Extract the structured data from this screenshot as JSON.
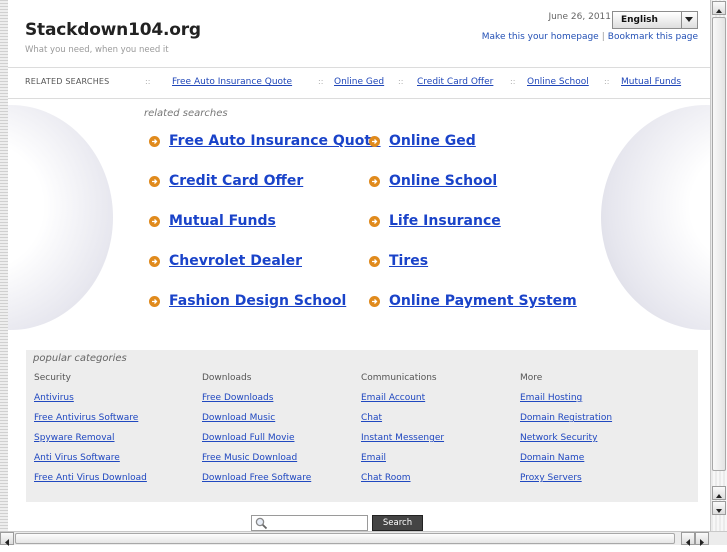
{
  "header": {
    "site_title": "Stackdown104.org",
    "tagline": "What you need, when you need it",
    "date": "June 26, 2011",
    "language": "English",
    "homepage_link": "Make this your homepage",
    "bookmark_link": "Bookmark this page"
  },
  "related_bar": {
    "label": "RELATED SEARCHES",
    "separator": "::",
    "links": [
      "Free Auto Insurance Quote",
      "Online Ged",
      "Credit Card Offer",
      "Online School",
      "Mutual Funds"
    ]
  },
  "related_searches": {
    "heading": "related searches",
    "left": [
      "Free Auto Insurance Quote",
      "Credit Card Offer",
      "Mutual Funds",
      "Chevrolet Dealer",
      "Fashion Design School"
    ],
    "right": [
      "Online Ged",
      "Online School",
      "Life Insurance",
      "Tires",
      "Online Payment System"
    ]
  },
  "popular": {
    "heading": "popular categories",
    "columns": [
      {
        "title": "Security",
        "links": [
          "Antivirus",
          "Free Antivirus Software",
          "Spyware Removal",
          "Anti Virus Software",
          "Free Anti Virus Download"
        ]
      },
      {
        "title": "Downloads",
        "links": [
          "Free Downloads",
          "Download Music",
          "Download Full Movie",
          "Free Music Download",
          "Download Free Software"
        ]
      },
      {
        "title": "Communications",
        "links": [
          "Email Account",
          "Chat",
          "Instant Messenger",
          "Email",
          "Chat Room"
        ]
      },
      {
        "title": "More",
        "links": [
          "Email Hosting",
          "Domain Registration",
          "Network Security",
          "Domain Name",
          "Proxy Servers"
        ]
      }
    ]
  },
  "search": {
    "placeholder": "",
    "button_label": "Search"
  },
  "colors": {
    "link": "#1a43c9",
    "arrow_bullet": "#e08a1c",
    "popular_bg": "#ededed"
  },
  "icons": {
    "bullet": "arrow-right-circle-icon",
    "search": "magnifier-icon",
    "dropdown": "chevron-down-icon"
  }
}
